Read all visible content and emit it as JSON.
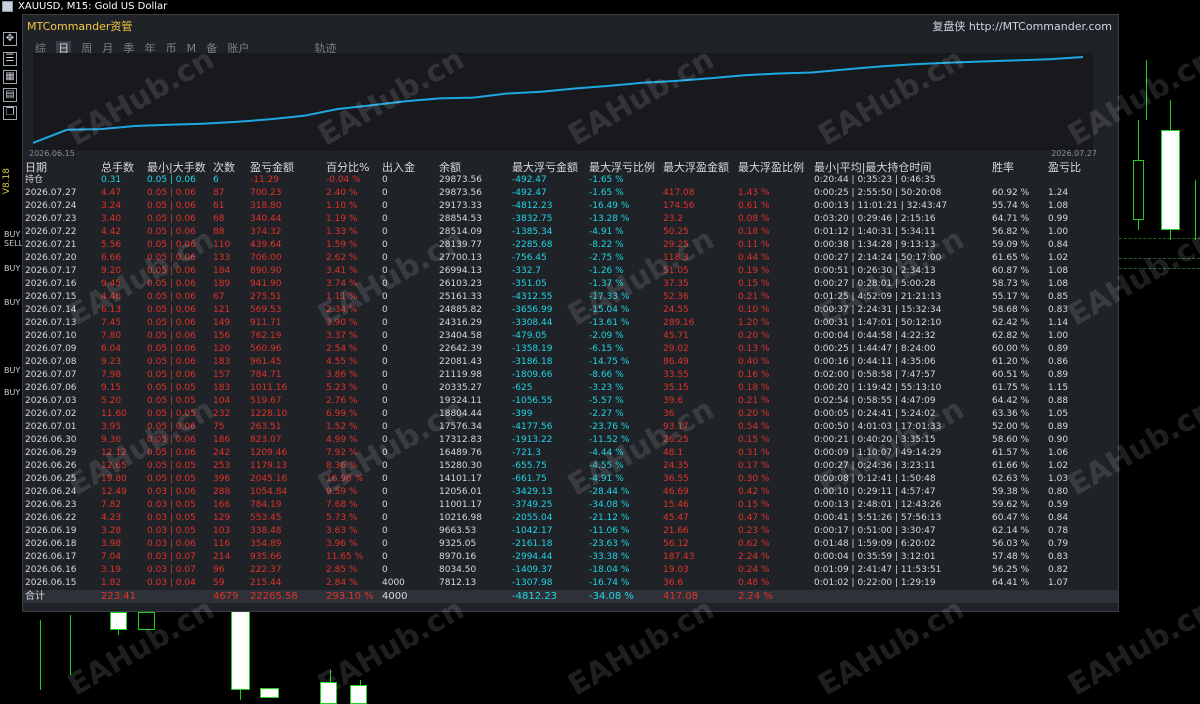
{
  "window": {
    "title": "XAUUSD, M15:  Gold US Dollar"
  },
  "side": {
    "version": "V8.18",
    "tags": [
      "BUY",
      "SELL",
      "BUY",
      "BUY",
      "BUY",
      "BUY"
    ]
  },
  "panel": {
    "title": "MTCommander资管",
    "link": "复盘侠 http://MTCommander.com",
    "tabs": [
      "综",
      "日",
      "周",
      "月",
      "季",
      "年",
      "币",
      "M",
      "备",
      "账户",
      "轨迹"
    ],
    "active_tab": "日",
    "chart_start": "2026.06.15",
    "chart_end": "2026.07.27"
  },
  "table": {
    "headers": [
      "日期",
      "总手数",
      "最小|大手数",
      "次数",
      "盈亏金额",
      "百分比%",
      "出入金",
      "余额",
      "最大浮亏金额",
      "最大浮亏比例",
      "最大浮盈金额",
      "最大浮盈比例",
      "最小|平均|最大持仓时间",
      "胜率",
      "盈亏比"
    ],
    "holding": [
      "持仓",
      "0.31",
      "0.05 | 0.06",
      "6",
      "-11.29",
      "-0.04 %",
      "0",
      "29873.56",
      "-492.47",
      "-1.65 %",
      "",
      "",
      "0:20:44 | 0:35:23 | 0:46:35",
      "",
      ""
    ],
    "rows": [
      [
        "2026.07.27",
        "4.47",
        "0.05 | 0.06",
        "87",
        "700.23",
        "2.40 %",
        "0",
        "29873.56",
        "-492.47",
        "-1.65 %",
        "417.08",
        "1.43 %",
        "0:00:25 | 2:55:50 | 50:20:08",
        "60.92 %",
        "1.24"
      ],
      [
        "2026.07.24",
        "3.24",
        "0.05 | 0.06",
        "61",
        "318.80",
        "1.10 %",
        "0",
        "29173.33",
        "-4812.23",
        "-16.49 %",
        "174.56",
        "0.61 %",
        "0:00:13 | 11:01:21 | 32:43:47",
        "55.74 %",
        "1.08"
      ],
      [
        "2026.07.23",
        "3.40",
        "0.05 | 0.06",
        "68",
        "340.44",
        "1.19 %",
        "0",
        "28854.53",
        "-3832.75",
        "-13.28 %",
        "23.2",
        "0.08 %",
        "0:03:20 | 0:29:46 | 2:15:16",
        "64.71 %",
        "0.99"
      ],
      [
        "2026.07.22",
        "4.42",
        "0.05 | 0.06",
        "88",
        "374.32",
        "1.33 %",
        "0",
        "28514.09",
        "-1385.34",
        "-4.91 %",
        "50.25",
        "0.18 %",
        "0:01:12 | 1:40:31 | 5:34:11",
        "56.82 %",
        "1.00"
      ],
      [
        "2026.07.21",
        "5.56",
        "0.05 | 0.06",
        "110",
        "439.64",
        "1.59 %",
        "0",
        "28139.77",
        "-2285.68",
        "-8.22 %",
        "29.25",
        "0.11 %",
        "0:00:38 | 1:34:28 | 9:13:13",
        "59.09 %",
        "0.84"
      ],
      [
        "2026.07.20",
        "6.66",
        "0.05 | 0.06",
        "133",
        "706.00",
        "2.62 %",
        "0",
        "27700.13",
        "-756.45",
        "-2.75 %",
        "118.3",
        "0.44 %",
        "0:00:27 | 2:14:24 | 50:17:00",
        "61.65 %",
        "1.02"
      ],
      [
        "2026.07.17",
        "9.20",
        "0.05 | 0.06",
        "184",
        "890.90",
        "3.41 %",
        "0",
        "26994.13",
        "-332.7",
        "-1.26 %",
        "51.05",
        "0.19 %",
        "0:00:51 | 0:26:30 | 2:34:13",
        "60.87 %",
        "1.08"
      ],
      [
        "2026.07.16",
        "9.45",
        "0.05 | 0.06",
        "189",
        "941.90",
        "3.74 %",
        "0",
        "26103.23",
        "-351.05",
        "-1.37 %",
        "37.35",
        "0.15 %",
        "0:00:27 | 0:28:01 | 5:00:28",
        "58.73 %",
        "1.08"
      ],
      [
        "2026.07.15",
        "4.46",
        "0.05 | 0.06",
        "67",
        "275.51",
        "1.11 %",
        "0",
        "25161.33",
        "-4312.55",
        "-17.33 %",
        "52.36",
        "0.21 %",
        "0:01:25 | 4:52:09 | 21:21:13",
        "55.17 %",
        "0.85"
      ],
      [
        "2026.07.14",
        "6.13",
        "0.05 | 0.06",
        "121",
        "569.53",
        "2.34 %",
        "0",
        "24885.82",
        "-3656.99",
        "-15.04 %",
        "24.55",
        "0.10 %",
        "0:00:37 | 2:24:31 | 15:32:34",
        "58.68 %",
        "0.83"
      ],
      [
        "2026.07.13",
        "7.45",
        "0.05 | 0.06",
        "149",
        "911.71",
        "3.90 %",
        "0",
        "24316.29",
        "-3308.44",
        "-13.61 %",
        "289.16",
        "1.20 %",
        "0:00:31 | 1:47:01 | 50:12:10",
        "62.42 %",
        "1.14"
      ],
      [
        "2026.07.10",
        "7.80",
        "0.05 | 0.06",
        "156",
        "762.19",
        "3.37 %",
        "0",
        "23404.58",
        "-479.05",
        "-2.09 %",
        "45.71",
        "0.20 %",
        "0:00:04 | 0:44:58 | 4:22:32",
        "62.82 %",
        "1.00"
      ],
      [
        "2026.07.09",
        "6.04",
        "0.05 | 0.06",
        "120",
        "560.96",
        "2.54 %",
        "0",
        "22642.39",
        "-1358.19",
        "-6.15 %",
        "29.02",
        "0.13 %",
        "0:00:25 | 1:44:47 | 8:24:00",
        "60.00 %",
        "0.89"
      ],
      [
        "2026.07.08",
        "9.23",
        "0.05 | 0.06",
        "183",
        "961.45",
        "4.55 %",
        "0",
        "22081.43",
        "-3186.18",
        "-14.75 %",
        "86.49",
        "0.40 %",
        "0:00:16 | 0:44:11 | 4:35:06",
        "61.20 %",
        "0.86"
      ],
      [
        "2026.07.07",
        "7.98",
        "0.05 | 0.06",
        "157",
        "784.71",
        "3.86 %",
        "0",
        "21119.98",
        "-1809.66",
        "-8.66 %",
        "33.55",
        "0.16 %",
        "0:02:00 | 0:58:58 | 7:47:57",
        "60.51 %",
        "0.89"
      ],
      [
        "2026.07.06",
        "9.15",
        "0.05 | 0.05",
        "183",
        "1011.16",
        "5.23 %",
        "0",
        "20335.27",
        "-625",
        "-3.23 %",
        "35.15",
        "0.18 %",
        "0:00:20 | 1:19:42 | 55:13:10",
        "61.75 %",
        "1.15"
      ],
      [
        "2026.07.03",
        "5.20",
        "0.05 | 0.05",
        "104",
        "519.67",
        "2.76 %",
        "0",
        "19324.11",
        "-1056.55",
        "-5.57 %",
        "39.6",
        "0.21 %",
        "0:02:54 | 0:58:55 | 4:47:09",
        "64.42 %",
        "0.88"
      ],
      [
        "2026.07.02",
        "11.60",
        "0.05 | 0.05",
        "232",
        "1228.10",
        "6.99 %",
        "0",
        "18804.44",
        "-399",
        "-2.27 %",
        "36",
        "0.20 %",
        "0:00:05 | 0:24:41 | 5:24:02",
        "63.36 %",
        "1.05"
      ],
      [
        "2026.07.01",
        "3.95",
        "0.05 | 0.06",
        "75",
        "263.51",
        "1.52 %",
        "0",
        "17576.34",
        "-4177.56",
        "-23.76 %",
        "93.17",
        "0.54 %",
        "0:00:50 | 4:01:03 | 17:01:33",
        "52.00 %",
        "0.89"
      ],
      [
        "2026.06.30",
        "9.36",
        "0.05 | 0.06",
        "186",
        "823.07",
        "4.99 %",
        "0",
        "17312.83",
        "-1913.22",
        "-11.52 %",
        "26.25",
        "0.15 %",
        "0:00:21 | 0:40:20 | 3:35:15",
        "58.60 %",
        "0.90"
      ],
      [
        "2026.06.29",
        "12.12",
        "0.05 | 0.06",
        "242",
        "1209.46",
        "7.92 %",
        "0",
        "16489.76",
        "-721.3",
        "-4.44 %",
        "48.1",
        "0.31 %",
        "0:00:09 | 1:10:07 | 49:14:29",
        "61.57 %",
        "1.06"
      ],
      [
        "2026.06.26",
        "12.65",
        "0.05 | 0.05",
        "253",
        "1179.13",
        "8.36 %",
        "0",
        "15280.30",
        "-655.75",
        "-4.55 %",
        "24.35",
        "0.17 %",
        "0:00:27 | 0:24:36 | 3:23:11",
        "61.66 %",
        "1.02"
      ],
      [
        "2026.06.25",
        "19.80",
        "0.05 | 0.05",
        "396",
        "2045.16",
        "16.96 %",
        "0",
        "14101.17",
        "-661.75",
        "-4.91 %",
        "36.55",
        "0.30 %",
        "0:00:08 | 0:12:41 | 1:50:48",
        "62.63 %",
        "1.03"
      ],
      [
        "2026.06.24",
        "12.49",
        "0.03 | 0.06",
        "288",
        "1054.84",
        "9.59 %",
        "0",
        "12056.01",
        "-3429.13",
        "-28.44 %",
        "46.69",
        "0.42 %",
        "0:00:10 | 0:29:11 | 4:57:47",
        "59.38 %",
        "0.80"
      ],
      [
        "2026.06.23",
        "7.82",
        "0.03 | 0.05",
        "166",
        "784.19",
        "7.68 %",
        "0",
        "11001.17",
        "-3749.25",
        "-34.08 %",
        "15.46",
        "0.15 %",
        "0:00:13 | 2:48:01 | 12:43:26",
        "59.62 %",
        "0.59"
      ],
      [
        "2026.06.22",
        "4.23",
        "0.03 | 0.05",
        "129",
        "553.45",
        "5.73 %",
        "0",
        "10216.98",
        "-2055.04",
        "-21.12 %",
        "45.47",
        "0.47 %",
        "0:00:41 | 5:51:26 | 57:56:13",
        "60.47 %",
        "0.84"
      ],
      [
        "2026.06.19",
        "3.28",
        "0.03 | 0.05",
        "103",
        "338.48",
        "3.63 %",
        "0",
        "9663.53",
        "-1042.17",
        "-11.06 %",
        "21.66",
        "0.23 %",
        "0:00:17 | 0:51:00 | 3:30:47",
        "62.14 %",
        "0.78"
      ],
      [
        "2026.06.18",
        "3.98",
        "0.03 | 0.06",
        "116",
        "354.89",
        "3.96 %",
        "0",
        "9325.05",
        "-2161.18",
        "-23.63 %",
        "56.12",
        "0.62 %",
        "0:01:48 | 1:59:09 | 6:20:02",
        "56.03 %",
        "0.79"
      ],
      [
        "2026.06.17",
        "7.04",
        "0.03 | 0.07",
        "214",
        "935.66",
        "11.65 %",
        "0",
        "8970.16",
        "-2994.44",
        "-33.38 %",
        "187.43",
        "2.24 %",
        "0:00:04 | 0:35:59 | 3:12:01",
        "57.48 %",
        "0.83"
      ],
      [
        "2026.06.16",
        "3.19",
        "0.03 | 0.07",
        "96",
        "222.37",
        "2.85 %",
        "0",
        "8034.50",
        "-1409.37",
        "-18.04 %",
        "19.03",
        "0.24 %",
        "0:01:09 | 2:41:47 | 11:53:51",
        "56.25 %",
        "0.82"
      ],
      [
        "2026.06.15",
        "1.82",
        "0.03 | 0.04",
        "59",
        "215.44",
        "2.84 %",
        "4000",
        "7812.13",
        "-1307.98",
        "-16.74 %",
        "36.6",
        "0.48 %",
        "0:01:02 | 0:22:00 | 1:29:19",
        "64.41 %",
        "1.07"
      ]
    ],
    "total": [
      "合计",
      "223.41",
      "",
      "4679",
      "22265.58",
      "293.10 %",
      "4000",
      "",
      "-4812.23",
      "-34.08 %",
      "417.08",
      "2.24 %",
      "",
      "",
      ""
    ]
  },
  "watermark": "EAHub.cn",
  "colors": {
    "background": "#000000",
    "panel": "#1f2227",
    "title": "#f2c744",
    "curve": "#1ea7e1",
    "negative_red": "#e0322a",
    "cyan": "#1fd6e6",
    "candle_green": "#1fd11f"
  }
}
